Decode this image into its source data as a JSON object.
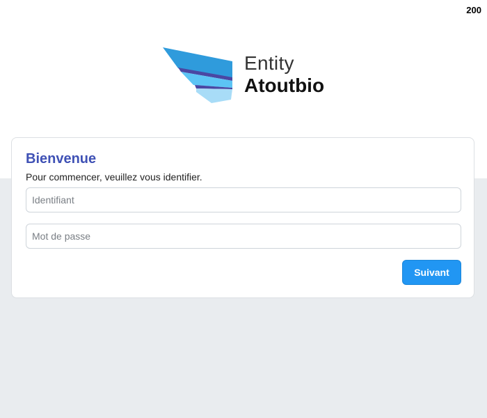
{
  "status_code": "200",
  "brand": {
    "line1": "Entity",
    "line2": "Atoutbio",
    "logo_icon": "wing-logo-icon",
    "colors": {
      "primary_blue": "#2f9bdc",
      "purple_stripe": "#4a47a3",
      "light_blue": "#5cc4f5",
      "pale_blue": "#a8dcf7"
    }
  },
  "login": {
    "title": "Bienvenue",
    "subtitle": "Pour commencer, veuillez vous identifier.",
    "username_placeholder": "Identifiant",
    "username_value": "",
    "password_placeholder": "Mot de passe",
    "password_value": "",
    "submit_label": "Suivant"
  },
  "colors": {
    "title": "#3f51b5",
    "button": "#2196f3",
    "page_background": "#e9ecef"
  }
}
